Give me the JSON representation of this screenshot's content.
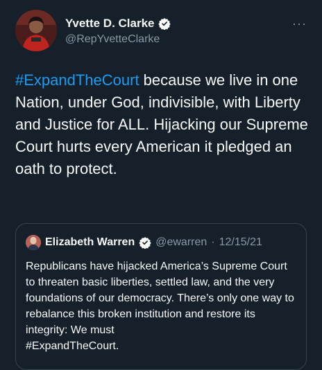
{
  "tweet": {
    "author_name": "Yvette D. Clarke",
    "author_handle": "@RepYvetteClarke",
    "more_label": "···",
    "hashtag": "#ExpandTheCourt",
    "text_rest": " because we live in one Nation, under God, indivisible, with Liberty and Justice for ALL. Hijacking our Supreme Court hurts every American it pledged an oath to protect."
  },
  "quoted_tweet": {
    "author_name": "Elizabeth Warren",
    "author_handle": "@ewarren",
    "separator": "·",
    "date": "12/15/21",
    "text": "Republicans have hijacked America’s Supreme Court to threaten basic liberties, settled law, and the very foundations of our democracy. There’s only one way to rebalance this broken institution and restore its integrity: We must",
    "hashtag": "#ExpandTheCourt."
  },
  "icons": {
    "verified": "verified-badge-icon",
    "more": "more-options-icon"
  },
  "colors": {
    "background": "#15202b",
    "accent": "#1d9bf0",
    "text": "#f7f9f9",
    "secondary_text": "#8b98a5",
    "border": "#38444d"
  }
}
